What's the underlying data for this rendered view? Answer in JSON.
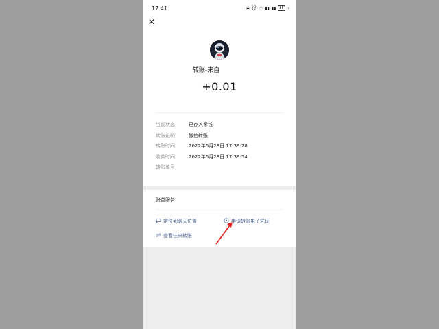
{
  "status_bar": {
    "time": "17:41",
    "icons": [
      "bluetooth-icon",
      "data-speed-icon",
      "wifi-icon",
      "signal-icon",
      "signal-icon",
      "battery-icon"
    ],
    "network_speed": "5.1 K/s",
    "battery": "85"
  },
  "header": {
    "close_icon": "close-icon"
  },
  "transfer": {
    "from_label": "转账-来自",
    "amount": "+0.01"
  },
  "details": [
    {
      "key": "当前状态",
      "value": "已存入零钱"
    },
    {
      "key": "转账说明",
      "value": "微信转账"
    },
    {
      "key": "转账时间",
      "value": "2022年5月23日 17:39:28"
    },
    {
      "key": "收款时间",
      "value": "2022年5月23日 17:39:54"
    },
    {
      "key": "转账单号",
      "value": ""
    }
  ],
  "bill_services": {
    "title": "账单服务",
    "links": [
      {
        "label": "定位到聊天位置",
        "icon": "chat-bubble-icon"
      },
      {
        "label": "申请转账电子凭证",
        "icon": "target-icon"
      },
      {
        "label": "查看往来转账",
        "icon": "swap-arrows-icon"
      }
    ]
  },
  "colors": {
    "link": "#576b95",
    "arrow": "#e02020",
    "backdrop": "#9e9e9e",
    "page_bg": "#ededed"
  }
}
